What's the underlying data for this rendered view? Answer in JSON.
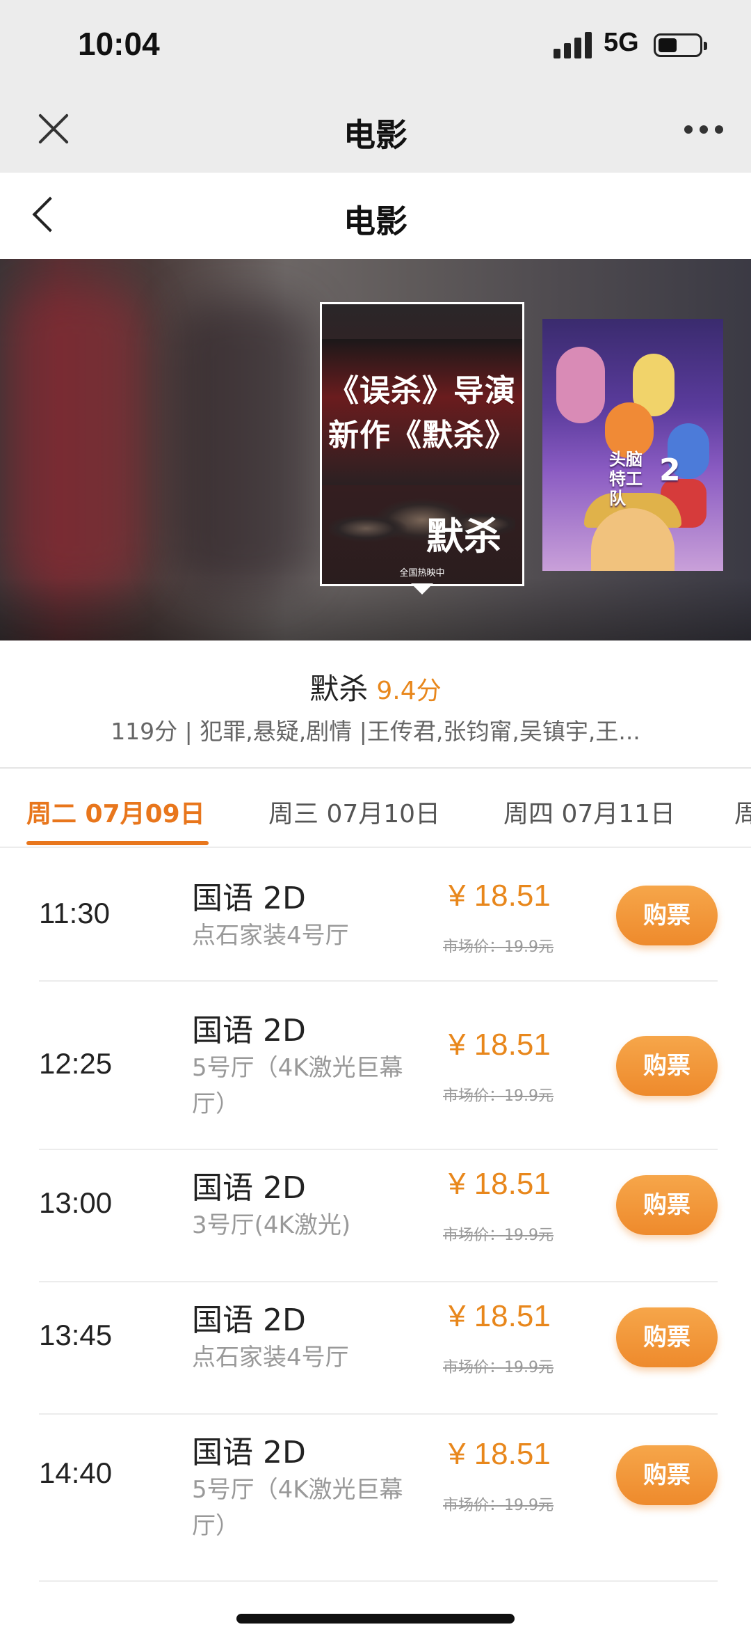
{
  "status_bar": {
    "time": "10:04",
    "network": "5G"
  },
  "top_bar": {
    "title": "电影"
  },
  "page_header": {
    "title": "电影"
  },
  "posters": [
    {
      "line1": "《误杀》导演",
      "line2": "新作《默杀》",
      "logo": "默杀",
      "tag": "全国热映中"
    },
    {
      "title": "头脑特工队",
      "number": "2"
    }
  ],
  "movie": {
    "name": "默杀",
    "score": "9.4分",
    "meta": "119分 | 犯罪,悬疑,剧情 |王传君,张钧甯,吴镇宇,王..."
  },
  "date_tabs": [
    {
      "label": "周二 07月09日",
      "active": true
    },
    {
      "label": "周三 07月10日",
      "active": false
    },
    {
      "label": "周四 07月11日",
      "active": false
    },
    {
      "label": "周",
      "active": false
    }
  ],
  "showtimes": [
    {
      "time": "11:30",
      "lang": "国语 2D",
      "hall": "点石家装4号厅",
      "price": "¥ 18.51",
      "market": "市场价：19.9元",
      "button": "购票"
    },
    {
      "time": "12:25",
      "lang": "国语 2D",
      "hall": "5号厅（4K激光巨幕厅）",
      "price": "¥ 18.51",
      "market": "市场价：19.9元",
      "button": "购票"
    },
    {
      "time": "13:00",
      "lang": "国语 2D",
      "hall": "3号厅(4K激光)",
      "price": "¥ 18.51",
      "market": "市场价：19.9元",
      "button": "购票"
    },
    {
      "time": "13:45",
      "lang": "国语 2D",
      "hall": "点石家装4号厅",
      "price": "¥ 18.51",
      "market": "市场价：19.9元",
      "button": "购票"
    },
    {
      "time": "14:40",
      "lang": "国语 2D",
      "hall": "5号厅（4K激光巨幕厅）",
      "price": "¥ 18.51",
      "market": "市场价：19.9元",
      "button": "购票"
    }
  ],
  "colors": {
    "accent": "#e8761c",
    "price": "#e8871c",
    "button": "#f09436"
  }
}
